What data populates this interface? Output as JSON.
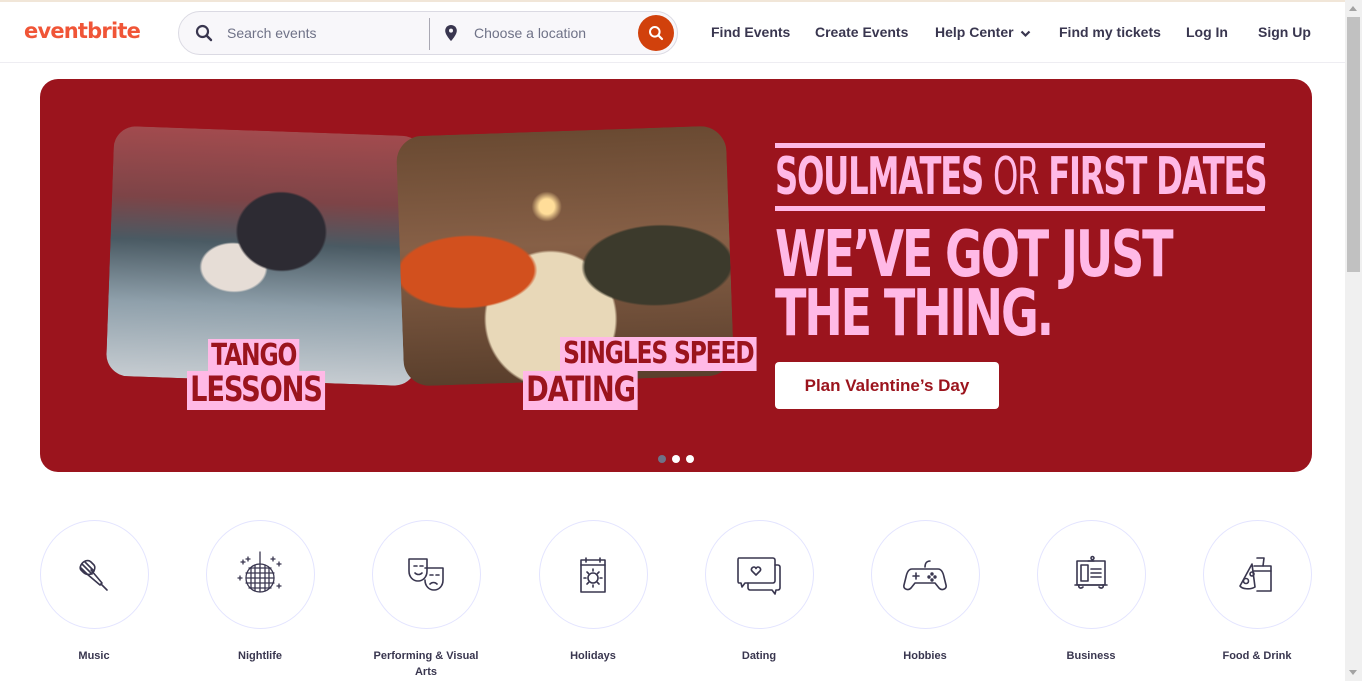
{
  "header": {
    "logo": "eventbrite",
    "search": {
      "events_placeholder": "Search events",
      "location_placeholder": "Choose a location"
    },
    "nav": [
      {
        "label": "Find Events"
      },
      {
        "label": "Create Events"
      },
      {
        "label": "Help Center",
        "has_dropdown": true
      },
      {
        "label": "Find my tickets"
      },
      {
        "label": "Log In"
      },
      {
        "label": "Sign Up"
      }
    ]
  },
  "hero": {
    "background_color": "#9b141d",
    "accent_color": "#ffb9e6",
    "photos": [
      {
        "alt": "Couple dancing tango in a plaza",
        "label_line1": "TANGO",
        "label_line2": "LESSONS"
      },
      {
        "alt": "Couple on candlelit dinner date",
        "label_line1": "SINGLES SPEED",
        "label_line2": "DATING"
      }
    ],
    "headline_small_1": "SOULMATES",
    "headline_small_or": "OR",
    "headline_small_2": "FIRST DATES",
    "headline_big_1": "WE’VE GOT JUST",
    "headline_big_2": "THE THING.",
    "cta_label": "Plan Valentine’s Day",
    "carousel": {
      "total": 3,
      "active_index": 0
    }
  },
  "categories": [
    {
      "label": "Music",
      "icon": "microphone-icon"
    },
    {
      "label": "Nightlife",
      "icon": "disco-ball-icon"
    },
    {
      "label": "Performing & Visual Arts",
      "icon": "theater-masks-icon"
    },
    {
      "label": "Holidays",
      "icon": "calendar-sun-icon"
    },
    {
      "label": "Dating",
      "icon": "chat-heart-icon"
    },
    {
      "label": "Hobbies",
      "icon": "gamepad-icon"
    },
    {
      "label": "Business",
      "icon": "presentation-board-icon"
    },
    {
      "label": "Food & Drink",
      "icon": "pizza-drink-icon"
    }
  ],
  "colors": {
    "brand": "#f05537",
    "search_button": "#d1410c",
    "text_dark": "#39364f"
  }
}
